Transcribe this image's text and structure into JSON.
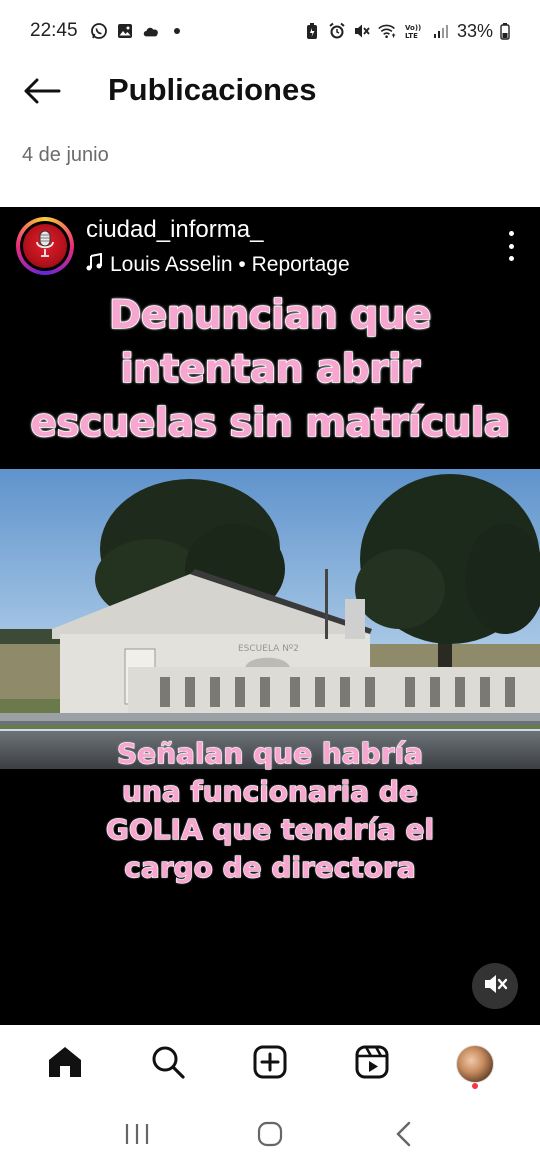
{
  "status_bar": {
    "time": "22:45",
    "battery": "33%",
    "left_icons": [
      "whatsapp-icon",
      "image-icon",
      "cloud-icon",
      "dot-icon"
    ],
    "right_icons": [
      "battery-saver-icon",
      "alarm-icon",
      "mute-icon",
      "wifi-icon",
      "volte-icon",
      "signal-icon",
      "battery-icon"
    ],
    "volte_label": "Vo)) LTE"
  },
  "header": {
    "title": "Publicaciones",
    "back_icon": "arrow-left-icon"
  },
  "post": {
    "date": "4 de junio",
    "username": "ciudad_informa_",
    "audio": "Louis Asselin • Reportage",
    "headline_lines": [
      "Denuncian que",
      "intentan abrir",
      "escuelas sin matrícula"
    ],
    "caption_lines": [
      "Señalan que habría",
      "una funcionaria de",
      "GOLIA que tendría el",
      "cargo de directora"
    ],
    "school_sign": "ESCUELA Nº2"
  },
  "bottom_nav": {
    "items": [
      "home-icon",
      "search-icon",
      "create-icon",
      "reels-icon",
      "profile-avatar"
    ]
  },
  "colors": {
    "headline_fill": "#f7a6cf",
    "headline_stroke": "#ffffff",
    "reel_bg": "#000000",
    "notification_dot": "#ff3040"
  }
}
